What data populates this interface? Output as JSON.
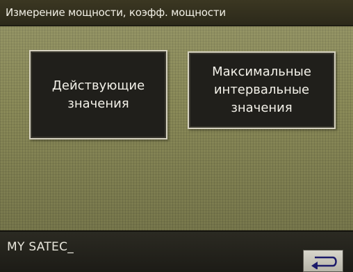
{
  "header": {
    "title": "Измерение мощности, коэфф. мощности"
  },
  "menu": {
    "actual_values": "Действующие\nзначения",
    "max_interval_values": "Максимальные\nинтервальные\nзначения"
  },
  "footer": {
    "device_name": "MY SATEC_",
    "back_icon": "return-arrow-icon"
  },
  "colors": {
    "screen_bg": "#8a8a58",
    "bar_bg": "#2c291a",
    "button_bg": "#201f1b",
    "button_border": "#d6d2c0"
  }
}
